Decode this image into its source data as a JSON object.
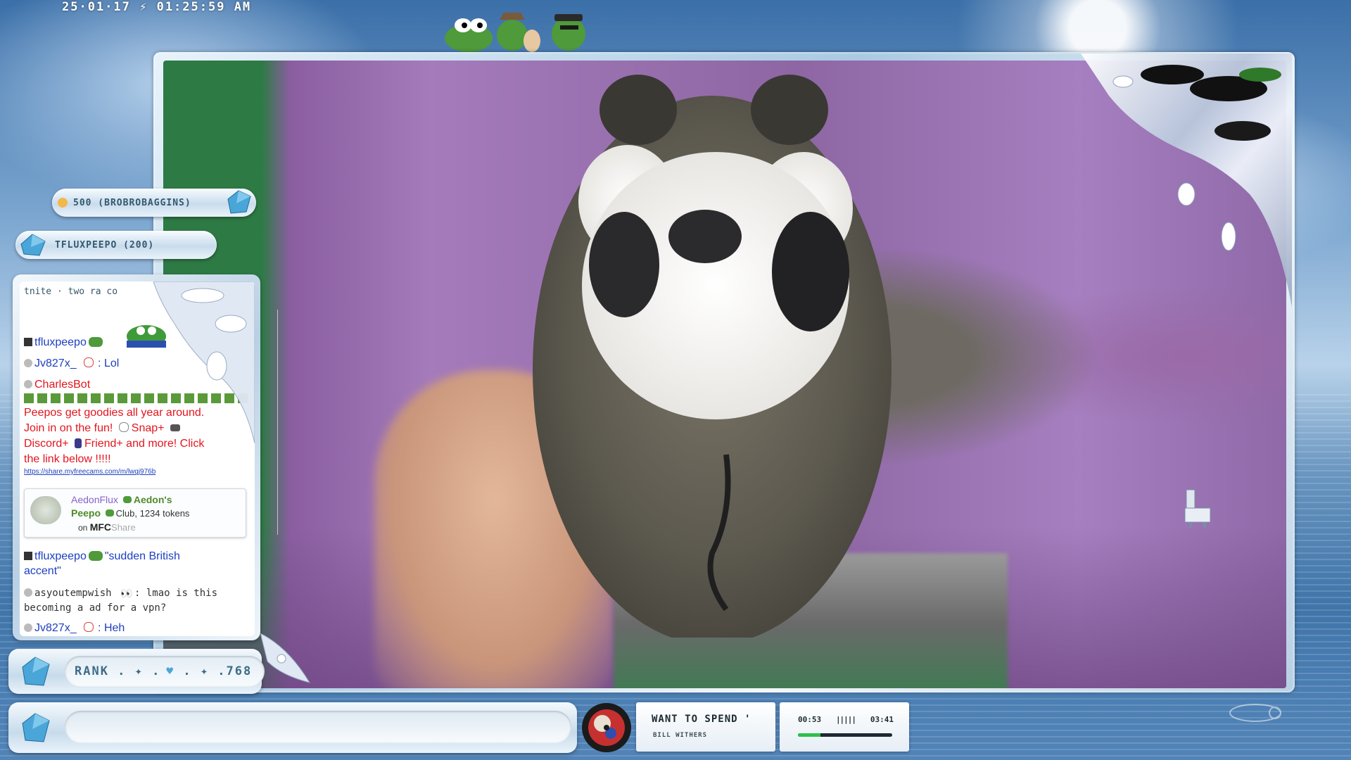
{
  "header": {
    "timestamp": "25·01·17 ⚡ 01:25:59 AM"
  },
  "donations": {
    "top": "500 (BROBROBAGGINS)",
    "second": "TFLUXPEEPO (200)"
  },
  "chat": {
    "partial_top": "tnite · two ra co",
    "messages": [
      {
        "user": "tfluxpeepo",
        "text": ""
      },
      {
        "user": "Jv827x_",
        "text": ": Lol"
      },
      {
        "user": "CharlesBot",
        "text": ""
      },
      {
        "bot_line1": "Peepos get goodies all year around.",
        "bot_line2": "Join in on the fun!",
        "bot_snap": "Snap+",
        "bot_discord": "Discord+",
        "bot_friend": "Friend+ and more! Click",
        "bot_link_text": "the link below !!!!!",
        "bot_url": "https://share.myfreecams.com/m/lwqj976b"
      },
      {
        "tip_user": "AedonFlux",
        "tip_club": "Aedon's",
        "tip_peepo": "Peepo",
        "tip_detail": "Club, 1234 tokens",
        "tip_on": "on",
        "tip_brand_a": "MFC",
        "tip_brand_b": "Share"
      },
      {
        "user": "tfluxpeepo",
        "text": "\"sudden British",
        "text2": "accent\""
      },
      {
        "user": "asyoutempwish",
        "text": ": lmao is this",
        "text2": "becoming a ad for a vpn?"
      },
      {
        "user": "Jv827x_",
        "text": ": Heh"
      }
    ]
  },
  "rank": {
    "label": "RANK . ✦ .",
    "value": ". ✦ .768"
  },
  "input": {
    "placeholder": ""
  },
  "now_playing": {
    "title": "WANT TO SPEND '",
    "artist": "BILL WITHERS",
    "elapsed": "00:53",
    "bars": "|||||",
    "duration": "03:41",
    "progress": 0.24
  },
  "colors": {
    "accent": "#2fbf4a",
    "bot_red": "#e3151e",
    "username_blue": "#1d3fbf",
    "username_purple": "#8a63c9"
  }
}
